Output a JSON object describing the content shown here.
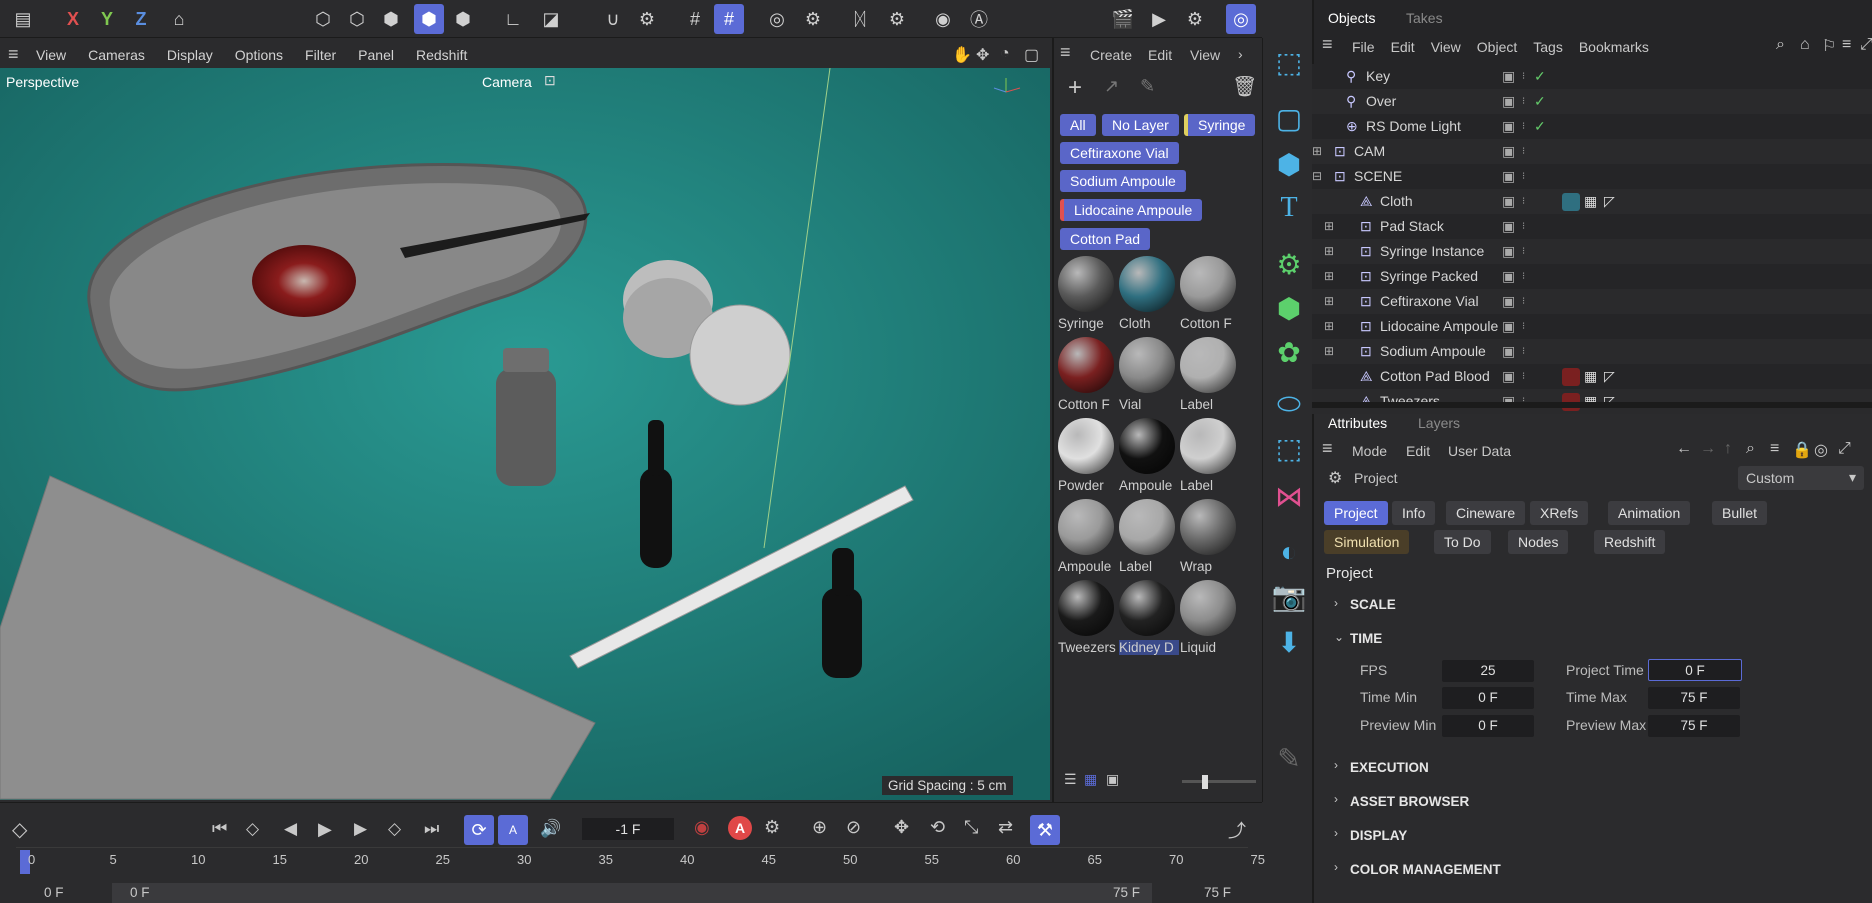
{
  "colors": {
    "accent": "#5b6bd6",
    "viewport_bg": "#1e7a78",
    "check": "#63c96a"
  },
  "viewport": {
    "menu": [
      "View",
      "Cameras",
      "Display",
      "Options",
      "Filter",
      "Panel",
      "Redshift"
    ],
    "label_perspective": "Perspective",
    "label_camera": "Camera",
    "grid_spacing": "Grid Spacing : 5 cm"
  },
  "toolbar_axes": {
    "x": "X",
    "y": "Y",
    "z": "Z"
  },
  "materials": {
    "menu": [
      "Create",
      "Edit",
      "View"
    ],
    "filters": [
      "All",
      "No Layer",
      "Syringe",
      "Ceftiraxone Vial",
      "Sodium Ampoule",
      "Lidocaine Ampoule",
      "Cotton Pad"
    ],
    "items": [
      {
        "name": "Syringe",
        "color": "#5a5a5a"
      },
      {
        "name": "Cloth",
        "color": "#2f6f80"
      },
      {
        "name": "Cotton F",
        "color": "#9a9a9a"
      },
      {
        "name": "Cotton F",
        "color": "#7a2020"
      },
      {
        "name": "Vial",
        "color": "#8a8a8a"
      },
      {
        "name": "Label",
        "color": "#b0b0b0"
      },
      {
        "name": "Powder",
        "color": "#e0e0e0"
      },
      {
        "name": "Ampoule",
        "color": "#111111"
      },
      {
        "name": "Label",
        "color": "#cfcfcf"
      },
      {
        "name": "Ampoule",
        "color": "#9a9a9a"
      },
      {
        "name": "Label",
        "color": "#a8a8a8"
      },
      {
        "name": "Wrap",
        "color": "#6a6a6a"
      },
      {
        "name": "Tweezers",
        "color": "#1a1a1a"
      },
      {
        "name": "Kidney D",
        "color": "#222222"
      },
      {
        "name": "Liquid",
        "color": "#8c8c8c"
      }
    ]
  },
  "objects_panel": {
    "tabs": [
      "Objects",
      "Takes"
    ],
    "menu": [
      "File",
      "Edit",
      "View",
      "Object",
      "Tags",
      "Bookmarks"
    ],
    "rows": [
      {
        "name": "Key",
        "icon": "light-icon"
      },
      {
        "name": "Over",
        "icon": "light-icon"
      },
      {
        "name": "RS Dome Light",
        "icon": "dome-light-icon"
      },
      {
        "name": "CAM",
        "icon": "null-icon"
      },
      {
        "name": "SCENE",
        "icon": "null-icon"
      },
      {
        "name": "Cloth",
        "icon": "cloth-icon"
      },
      {
        "name": "Pad Stack",
        "icon": "null-icon"
      },
      {
        "name": "Syringe Instance",
        "icon": "null-icon"
      },
      {
        "name": "Syringe Packed",
        "icon": "null-icon"
      },
      {
        "name": "Ceftiraxone Vial",
        "icon": "null-icon"
      },
      {
        "name": "Lidocaine Ampoule",
        "icon": "null-icon"
      },
      {
        "name": "Sodium Ampoule",
        "icon": "null-icon"
      },
      {
        "name": "Cotton Pad Blood",
        "icon": "cloth-icon"
      },
      {
        "name": "Tweezers",
        "icon": "cloth-icon"
      }
    ]
  },
  "attributes": {
    "tabs": [
      "Attributes",
      "Layers"
    ],
    "menu": [
      "Mode",
      "Edit",
      "User Data"
    ],
    "object_name": "Project",
    "preset": "Custom",
    "tab_row1": [
      "Project",
      "Info",
      "Cineware",
      "XRefs",
      "Animation",
      "Bullet"
    ],
    "tab_row2": [
      "Simulation",
      "To Do",
      "Nodes",
      "Redshift"
    ],
    "heading": "Project",
    "sections": {
      "scale": "SCALE",
      "time": "TIME",
      "execution": "EXECUTION",
      "asset_browser": "ASSET BROWSER",
      "display": "DISPLAY",
      "color_management": "COLOR MANAGEMENT"
    },
    "fields": {
      "fps_label": "FPS",
      "fps": "25",
      "project_time_label": "Project Time",
      "project_time": "0 F",
      "time_min_label": "Time Min",
      "time_min": "0 F",
      "time_max_label": "Time Max",
      "time_max": "75 F",
      "preview_min_label": "Preview Min",
      "preview_min": "0 F",
      "preview_max_label": "Preview Max",
      "preview_max": "75 F"
    }
  },
  "timeline": {
    "current_frame": "-1 F",
    "ticks": [
      "0",
      "5",
      "10",
      "15",
      "20",
      "25",
      "30",
      "35",
      "40",
      "45",
      "50",
      "55",
      "60",
      "65",
      "70",
      "75"
    ],
    "start": "0 F",
    "range_start": "0 F",
    "range_end": "75 F",
    "end": "75 F"
  }
}
